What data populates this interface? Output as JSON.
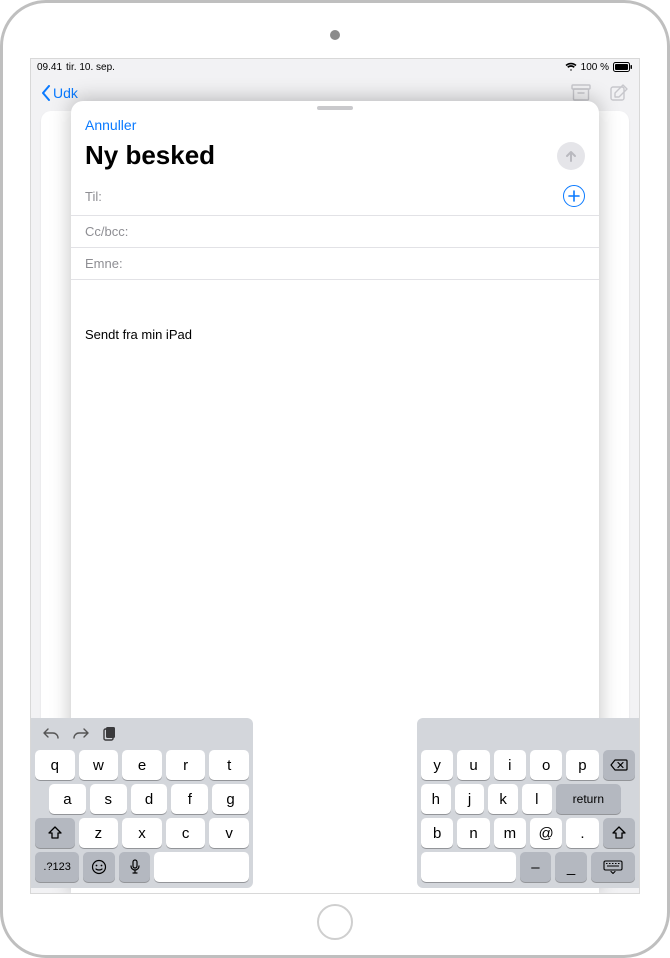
{
  "status": {
    "time": "09.41",
    "date": "tir. 10. sep.",
    "battery": "100 %"
  },
  "bgNav": {
    "backLabel": "Udk"
  },
  "sheet": {
    "cancel": "Annuller",
    "title": "Ny besked",
    "toLabel": "Til:",
    "ccLabel": "Cc/bcc:",
    "subjectLabel": "Emne:",
    "signature": "Sendt fra min iPad"
  },
  "keyboard": {
    "leftRows": {
      "r1": [
        "q",
        "w",
        "e",
        "r",
        "t"
      ],
      "r2": [
        "a",
        "s",
        "d",
        "f",
        "g"
      ],
      "r3": [
        "z",
        "x",
        "c",
        "v"
      ]
    },
    "rightRows": {
      "r1": [
        "y",
        "u",
        "i",
        "o",
        "p"
      ],
      "r2": [
        "h",
        "j",
        "k",
        "l"
      ],
      "r3": [
        "b",
        "n",
        "m",
        "@",
        "."
      ]
    },
    "numKey": ".?123",
    "returnKey": "return"
  }
}
